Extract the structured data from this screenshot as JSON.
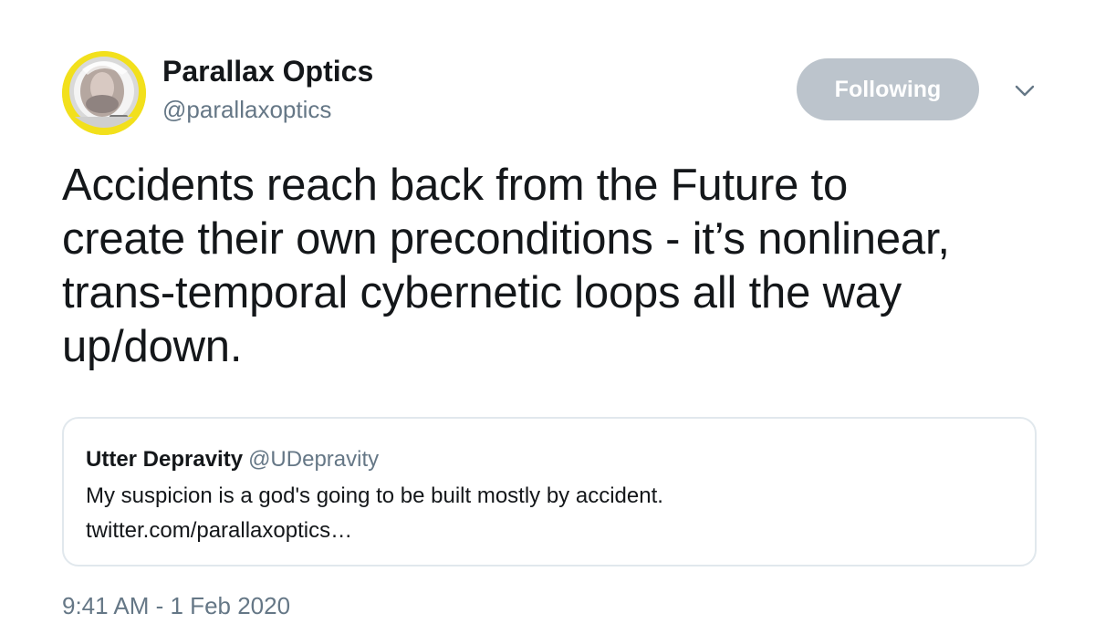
{
  "author": {
    "display_name": "Parallax Optics",
    "handle": "@parallaxoptics",
    "avatar_icon": "astronaut-helmet-avatar",
    "avatar_color": "#f2e01c"
  },
  "follow_button": {
    "label": "Following",
    "color": "#bcc4cc"
  },
  "menu_icon": "chevron-down-icon",
  "tweet": {
    "text": "Accidents reach back from the Future to\ncreate their own preconditions - it’s nonlinear,\ntrans-temporal cybernetic loops  all the way\nup/down."
  },
  "quoted_tweet": {
    "display_name": "Utter Depravity",
    "handle": "@UDepravity",
    "text": "My suspicion is a god's going to be built mostly by accident.",
    "link": "twitter.com/parallaxoptics…"
  },
  "timestamp": "9:41 AM - 1 Feb 2020"
}
